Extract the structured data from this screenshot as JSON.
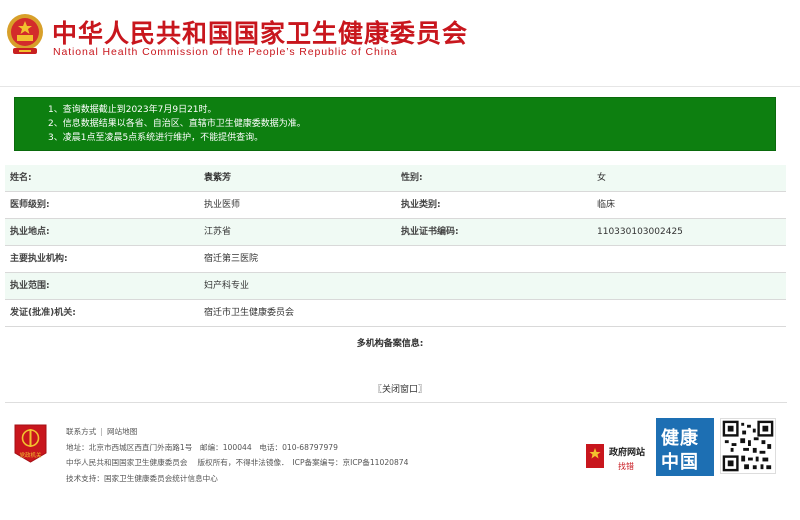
{
  "header": {
    "title_cn": "中华人民共和国国家卫生健康委员会",
    "title_en": "National Health Commission of the People’s Republic of China",
    "emblem_icon": "national-emblem-icon"
  },
  "notice": {
    "lines": [
      "1、查询数据截止到2023年7月9日21时。",
      "2、信息数据结果以各省、自治区、直辖市卫生健康委数据为准。",
      "3、凌晨1点至凌晨5点系统进行维护，不能提供查询。"
    ]
  },
  "info": {
    "name_label": "姓名:",
    "name_value": "袁紫芳",
    "gender_label": "性别:",
    "gender_value": "女",
    "level_label": "医师级别:",
    "level_value": "执业医师",
    "category_label": "执业类别:",
    "category_value": "临床",
    "location_label": "执业地点:",
    "location_value": "江苏省",
    "cert_label": "执业证书编码:",
    "cert_value": "110330103002425",
    "institution_label": "主要执业机构:",
    "institution_value": "宿迁第三医院",
    "scope_label": "执业范围:",
    "scope_value": "妇产科专业",
    "issuer_label": "发证(批准)机关:",
    "issuer_value": "宿迁市卫生健康委员会",
    "multi_label": "多机构备案信息:"
  },
  "close_label": "〖关闭窗口〗",
  "footer": {
    "contact": "联系方式",
    "sitemap": "网站地图",
    "separator": "|",
    "address": "地址：北京市西城区西直门外南路1号　邮编：100044　电话：010-68797979",
    "copyright": "中华人民共和国国家卫生健康委员会　 版权所有，不得非法镜像．　ICP备案编号：京ICP备11020874",
    "support": "技术支持：国家卫生健康委员会统计信息中心",
    "badge_text": "党政机关",
    "gov_site_title": "政府网站",
    "gov_site_sub": "找错",
    "health_line1": "健康",
    "health_line2": "中国"
  },
  "colors": {
    "brand_red": "#c8161d",
    "notice_green": "#0d7f10",
    "health_blue": "#1d6fb3"
  }
}
